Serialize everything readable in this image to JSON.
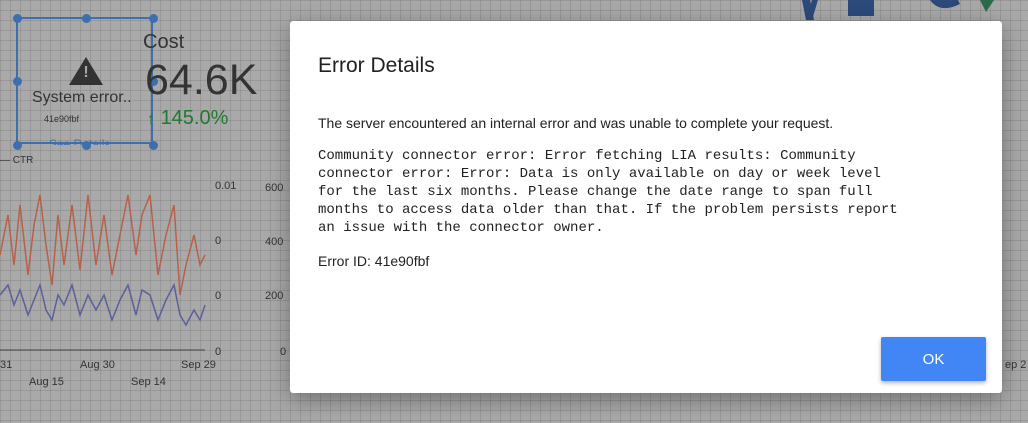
{
  "background": {
    "widget": {
      "error_title": "System error..",
      "error_id": "41e90fbf",
      "see_details": "See Details"
    },
    "kpi": {
      "label": "Cost",
      "value": "64.6K",
      "delta": "145.0%",
      "delta_color": "#1e7a2e"
    },
    "legend_label": "CTR",
    "right_axis_ticks": [
      "0.01",
      "0",
      "0",
      "0"
    ],
    "left_axis_ticks": [
      "600",
      "400",
      "200",
      "0"
    ],
    "x_ticks_row1": [
      "31",
      "Aug 30",
      "Sep 29"
    ],
    "x_ticks_row2": [
      "Aug 15",
      "Sep 14"
    ],
    "right_edge_tick": "ep 2"
  },
  "dialog": {
    "title": "Error Details",
    "message": "The server encountered an internal error and was unable to complete your request.",
    "details": "Community connector error: Error fetching LIA results: Community\nconnector error: Error: Data is only available on day or week level\nfor the last six months. Please change the date range to span full\nmonths to access data older than that. If the problem persists report\nan issue with the connector owner.",
    "error_id": "Error ID: 41e90fbf",
    "ok_label": "OK",
    "accent": "#4285f4"
  }
}
